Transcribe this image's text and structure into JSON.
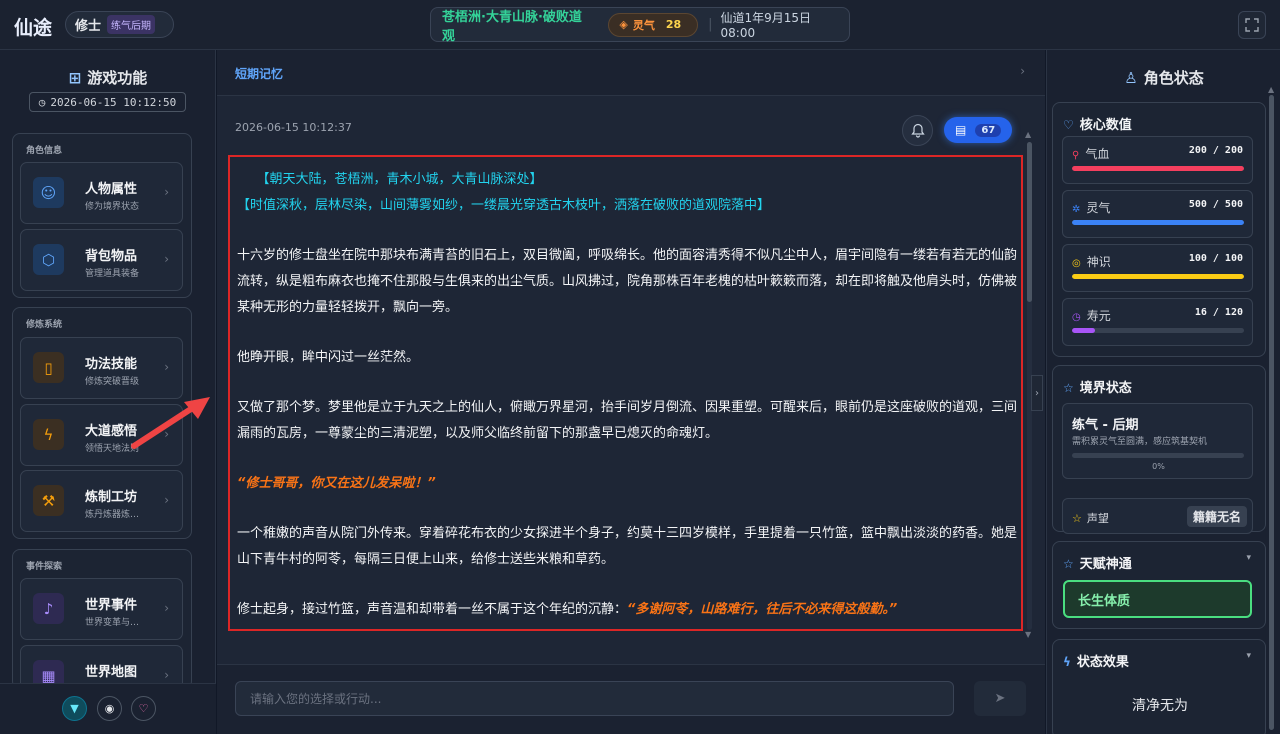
{
  "topbar": {
    "logo": "仙途",
    "player_name": "修士",
    "player_realm": "练气后期",
    "location": "苍梧洲·大青山脉·破败道观",
    "lingqi_label": "灵气",
    "lingqi_value": "28",
    "datetime": "仙道1年9月15日 08:00",
    "fullscreen_icon": "fullscreen-icon"
  },
  "left": {
    "title": "游戏功能",
    "datetime": "2026-06-15 10:12:50",
    "sections": [
      {
        "label": "角色信息",
        "items": [
          {
            "title": "人物属性",
            "subtitle": "修为境界状态",
            "icon": "person-icon"
          },
          {
            "title": "背包物品",
            "subtitle": "管理道具装备",
            "icon": "cube-icon"
          }
        ]
      },
      {
        "label": "修炼系统",
        "items": [
          {
            "title": "功法技能",
            "subtitle": "修炼突破晋级",
            "icon": "book-icon"
          },
          {
            "title": "大道感悟",
            "subtitle": "领悟天地法则",
            "icon": "lightning-icon"
          },
          {
            "title": "炼制工坊",
            "subtitle": "炼丹炼器炼…",
            "icon": "hammer-icon"
          }
        ]
      },
      {
        "label": "事件探索",
        "items": [
          {
            "title": "世界事件",
            "subtitle": "世界变革与…",
            "icon": "bell-icon"
          },
          {
            "title": "世界地图",
            "subtitle": "",
            "icon": "map-icon"
          }
        ]
      }
    ]
  },
  "center": {
    "memory_label": "短期记忆",
    "timestamp": "2026-06-15 10:12:37",
    "message_count": "67",
    "story": {
      "scene_line_1": "　　【朝天大陆，苍梧洲，青木小城，大青山脉深处】",
      "scene_line_2": "【时值深秋，层林尽染，山间薄雾如纱，一缕晨光穿透古木枝叶，洒落在破败的道观院落中】",
      "para1": "十六岁的修士盘坐在院中那块布满青苔的旧石上，双目微阖，呼吸绵长。他的面容清秀得不似凡尘中人，眉宇间隐有一缕若有若无的仙韵流转，纵是粗布麻衣也掩不住那股与生俱来的出尘气质。山风拂过，院角那株百年老槐的枯叶簌簌而落，却在即将触及他肩头时，仿佛被某种无形的力量轻轻拨开，飘向一旁。",
      "para2": "他睁开眼，眸中闪过一丝茫然。",
      "para3": "又做了那个梦。梦里他是立于九天之上的仙人，俯瞰万界星河，抬手间岁月倒流、因果重塑。可醒来后，眼前仍是这座破败的道观，三间漏雨的瓦房，一尊蒙尘的三清泥塑，以及师父临终前留下的那盏早已熄灭的命魂灯。",
      "para4": "“修士哥哥，你又在这儿发呆啦！”",
      "para5": "一个稚嫩的声音从院门外传来。穿着碎花布衣的少女探进半个身子，约莫十三四岁模样，手里提着一只竹篮，篮中飘出淡淡的药香。她是山下青牛村的阿苓，每隔三日便上山来，给修士送些米粮和草药。",
      "para6_a": "修士起身，接过竹篮，声音温和却带着一丝不属于这个年纪的沉静：",
      "para6_b": "“多谢阿苓，山路难行，往后不必来得这般勤。”"
    },
    "input_placeholder": "请输入您的选择或行动..."
  },
  "right": {
    "title": "角色状态",
    "core_title": "核心数值",
    "stats": [
      {
        "label": "气血",
        "value": "200 / 200",
        "ratio": 1.0,
        "color": "#f43f5e",
        "icon": "drop-icon"
      },
      {
        "label": "灵气",
        "value": "500 / 500",
        "ratio": 1.0,
        "color": "#3b82f6",
        "icon": "sparkle-icon"
      },
      {
        "label": "神识",
        "value": "100 / 100",
        "ratio": 1.0,
        "color": "#facc15",
        "icon": "mind-icon"
      },
      {
        "label": "寿元",
        "value": "16 / 120",
        "ratio": 0.133,
        "color": "#a855f7",
        "icon": "clock-icon"
      }
    ],
    "realm_title": "境界状态",
    "realm_name": "练气 - 后期",
    "realm_desc": "需积累灵气至圆满，感应筑基契机",
    "realm_progress": "0%",
    "fame_label": "声望",
    "fame_value": "籍籍无名",
    "talent_title": "天赋神通",
    "talent": "长生体质",
    "effects_title": "状态效果",
    "effects_empty": "清净无为"
  }
}
